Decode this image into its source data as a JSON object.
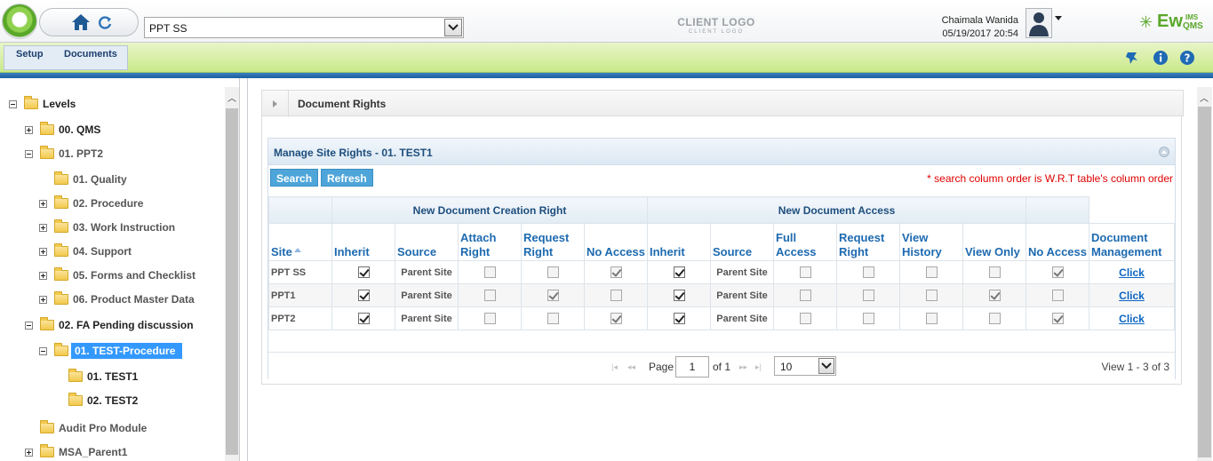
{
  "header": {
    "site_select_value": "PPT SS",
    "client_logo_text": "CLIENT LOGO",
    "client_logo_sub": "CLIENT LOGO",
    "user_name": "Chaimala Wanida",
    "user_datetime": "05/19/2017 20:54",
    "brand": {
      "ew": "Ew",
      "ims": "IMS",
      "qms": "QMS"
    }
  },
  "menu": {
    "setup": "Setup",
    "documents": "Documents"
  },
  "tree": [
    {
      "label": "Levels",
      "expander": "minus"
    },
    {
      "label": "00. QMS",
      "expander": "plus"
    },
    {
      "label": "01. PPT2",
      "expander": "minus"
    },
    {
      "label": "01. Quality",
      "expander": "none"
    },
    {
      "label": "02. Procedure",
      "expander": "plus"
    },
    {
      "label": "03. Work Instruction",
      "expander": "plus"
    },
    {
      "label": "04. Support",
      "expander": "plus"
    },
    {
      "label": "05. Forms and Checklist",
      "expander": "plus"
    },
    {
      "label": "06. Product Master Data",
      "expander": "plus"
    },
    {
      "label": "02. FA Pending discussion",
      "expander": "minus"
    },
    {
      "label": "01. TEST-Procedure",
      "expander": "minus",
      "selected": true
    },
    {
      "label": "01. TEST1",
      "expander": "none"
    },
    {
      "label": "02. TEST2",
      "expander": "none"
    },
    {
      "label": "Audit Pro Module",
      "expander": "none"
    },
    {
      "label": "MSA_Parent1",
      "expander": "plus"
    }
  ],
  "panel": {
    "title": "Document Rights",
    "grid_caption": "Manage Site Rights - 01. TEST1",
    "search_btn": "Search",
    "refresh_btn": "Refresh",
    "search_note": "* search column order is W.R.T table's column order"
  },
  "groups": {
    "creation": "New Document Creation Right",
    "access": "New Document Access"
  },
  "columns": [
    "Site",
    "Inherit",
    "Source",
    "Attach Right",
    "Request Right",
    "No Access",
    "Inherit",
    "Source",
    "Full Access",
    "Request Right",
    "View History",
    "View Only",
    "No Access",
    "Document Management"
  ],
  "rows": [
    {
      "site": "PPT SS",
      "inherit1": true,
      "source1": "Parent Site",
      "attach": false,
      "request1": false,
      "noaccess1": true,
      "inherit2": true,
      "source2": "Parent Site",
      "full": false,
      "request2": false,
      "history": false,
      "viewonly": false,
      "noaccess2": true,
      "link": "Click"
    },
    {
      "site": "PPT1",
      "inherit1": true,
      "source1": "Parent Site",
      "attach": false,
      "request1": true,
      "noaccess1": false,
      "inherit2": true,
      "source2": "Parent Site",
      "full": false,
      "request2": false,
      "history": false,
      "viewonly": true,
      "noaccess2": false,
      "link": "Click"
    },
    {
      "site": "PPT2",
      "inherit1": true,
      "source1": "Parent Site",
      "attach": false,
      "request1": false,
      "noaccess1": true,
      "inherit2": true,
      "source2": "Parent Site",
      "full": false,
      "request2": false,
      "history": false,
      "viewonly": false,
      "noaccess2": true,
      "link": "Click"
    }
  ],
  "pager": {
    "page_label": "Page",
    "page_value": "1",
    "of_label": "of 1",
    "rows_value": "10",
    "view_text": "View 1 - 3 of 3"
  }
}
